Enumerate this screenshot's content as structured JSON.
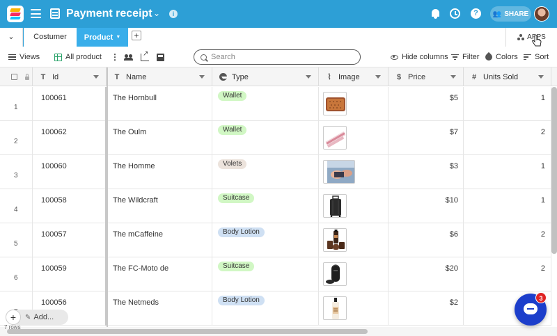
{
  "header": {
    "title": "Payment receipt",
    "share_label": "SHARE"
  },
  "tabs": [
    {
      "label": "Costumer",
      "active": false
    },
    {
      "label": "Product",
      "active": true
    }
  ],
  "apps_label": "APPS",
  "toolbar": {
    "views_label": "Views",
    "view_name": "All product",
    "search_placeholder": "Search",
    "hide_columns_label": "Hide columns",
    "filter_label": "Filter",
    "colors_label": "Colors",
    "sort_label": "Sort"
  },
  "columns": [
    {
      "label": "Id",
      "icon": "text-icon"
    },
    {
      "label": "Name",
      "icon": "text-icon"
    },
    {
      "label": "Type",
      "icon": "single-select-icon"
    },
    {
      "label": "Image",
      "icon": "attachment-icon"
    },
    {
      "label": "Price",
      "icon": "currency-icon"
    },
    {
      "label": "Units Sold",
      "icon": "number-icon"
    }
  ],
  "rows": [
    {
      "num": "1",
      "id": "100061",
      "name": "The Hornbull",
      "type": "Wallet",
      "type_color": "#d1f7c4",
      "price": "$5",
      "units": "1",
      "image": "wallet"
    },
    {
      "num": "2",
      "id": "100062",
      "name": "The Oulm",
      "type": "Wallet",
      "type_color": "#d1f7c4",
      "price": "$7",
      "units": "2",
      "image": "strap"
    },
    {
      "num": "3",
      "id": "100060",
      "name": "The Homme",
      "type": "Volets",
      "type_color": "#ece3dc",
      "price": "$3",
      "units": "1",
      "image": "hands"
    },
    {
      "num": "4",
      "id": "100058",
      "name": "The Wildcraft",
      "type": "Suitcase",
      "type_color": "#d1f7c4",
      "price": "$10",
      "units": "1",
      "image": "suitcase"
    },
    {
      "num": "5",
      "id": "100057",
      "name": "The mCaffeine",
      "type": "Body Lotion",
      "type_color": "#cfe0f3",
      "price": "$6",
      "units": "2",
      "image": "bottles"
    },
    {
      "num": "6",
      "id": "100059",
      "name": "The FC-Moto de",
      "type": "Suitcase",
      "type_color": "#d1f7c4",
      "price": "$20",
      "units": "2",
      "image": "duffel"
    },
    {
      "num": "7",
      "id": "100056",
      "name": "The Netmeds",
      "type": "Body Lotion",
      "type_color": "#cfe0f3",
      "price": "$2",
      "units": "1",
      "image": "lotion"
    }
  ],
  "footer": {
    "add_label": "Add...",
    "row_count": "7 rows"
  },
  "chat_badge": "3",
  "colors": {
    "topbar": "#2d9fd6",
    "active_tab": "#39aeea",
    "chat": "#1c3ecb"
  }
}
